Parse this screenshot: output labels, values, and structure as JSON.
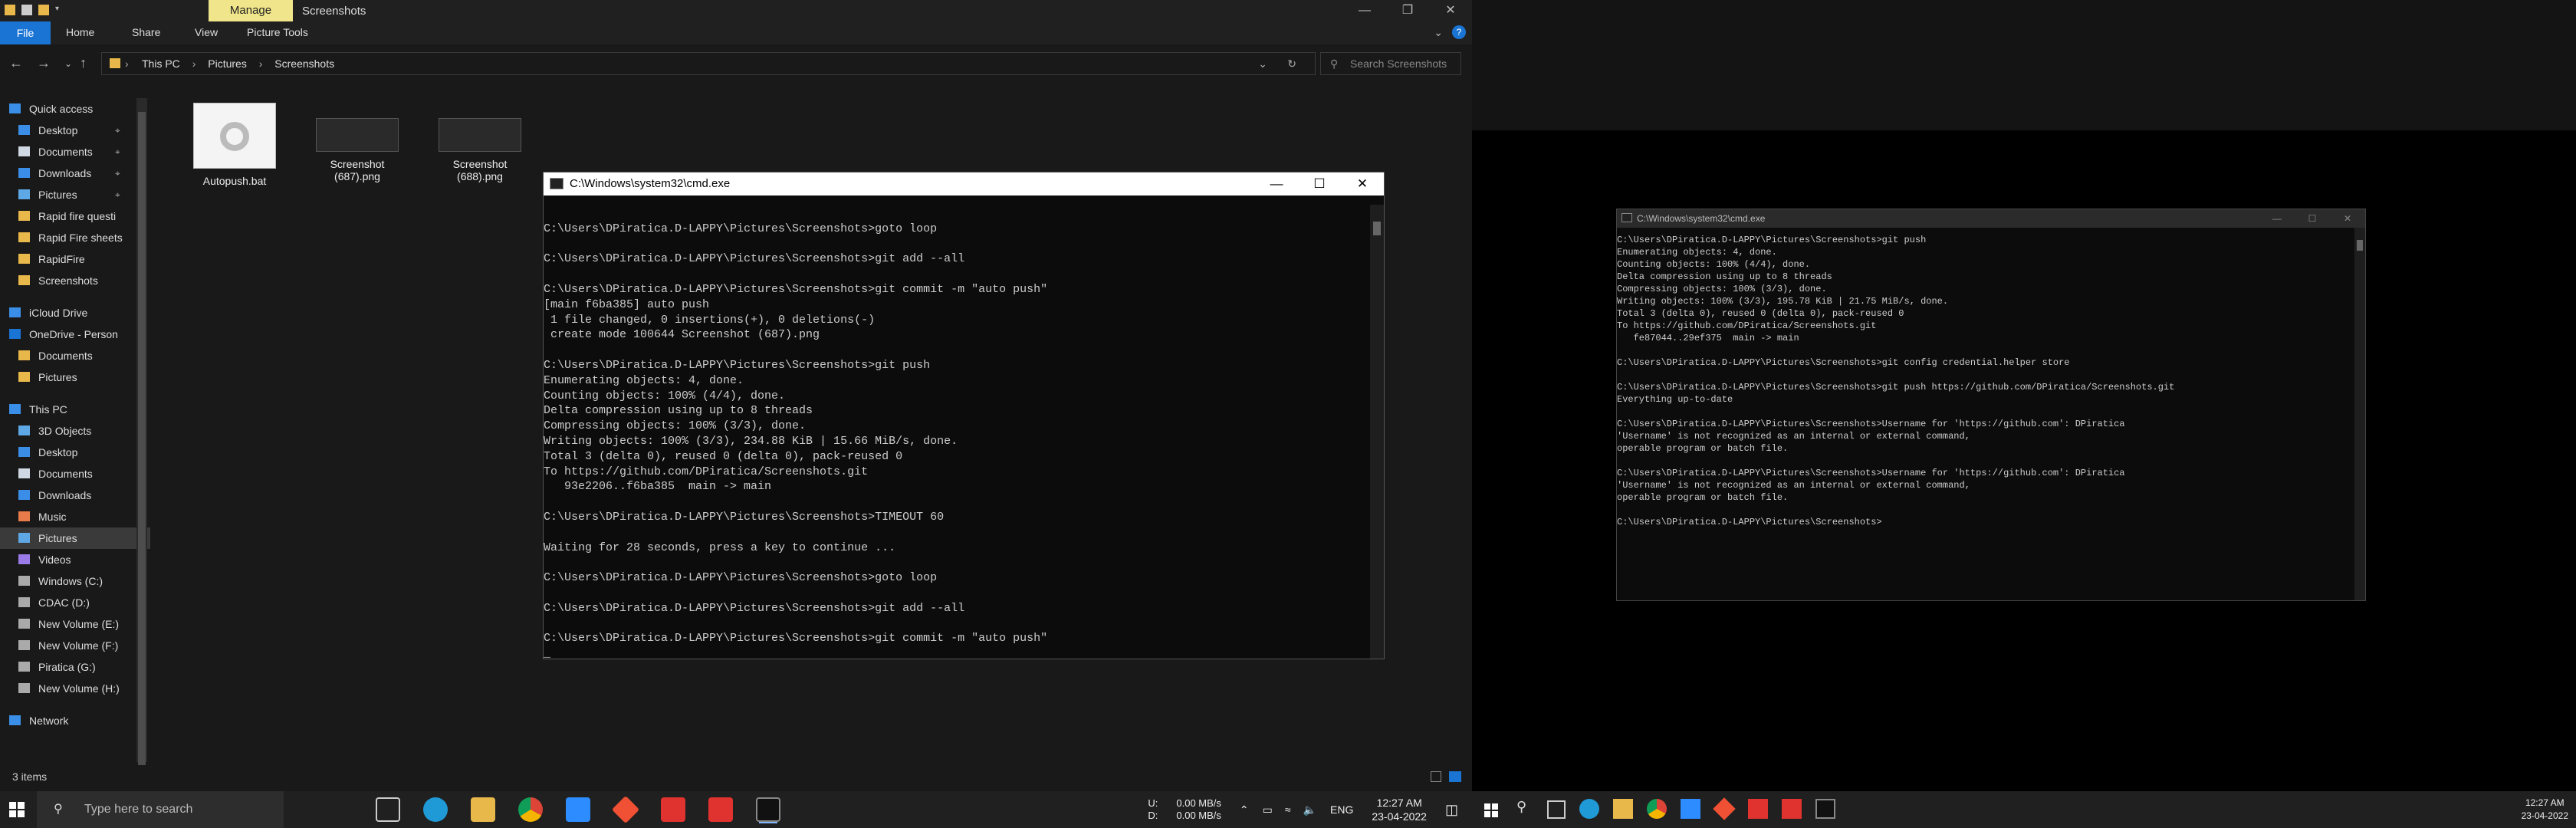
{
  "explorer": {
    "manage_tab": "Manage",
    "window_title": "Screenshots",
    "ribbon_tabs": [
      "File",
      "Home",
      "Share",
      "View",
      "Picture Tools"
    ],
    "breadcrumb": [
      "This PC",
      "Pictures",
      "Screenshots"
    ],
    "search_placeholder": "Search Screenshots",
    "nav_items": [
      {
        "label": "Quick access",
        "icon": "star-icon",
        "indent": 0
      },
      {
        "label": "Desktop",
        "icon": "desktop-icon",
        "indent": 1,
        "pinned": true
      },
      {
        "label": "Documents",
        "icon": "documents-icon",
        "indent": 1,
        "pinned": true
      },
      {
        "label": "Downloads",
        "icon": "downloads-icon",
        "indent": 1,
        "pinned": true
      },
      {
        "label": "Pictures",
        "icon": "pictures-icon",
        "indent": 1,
        "pinned": true
      },
      {
        "label": "Rapid fire questi",
        "icon": "folder-icon",
        "indent": 1
      },
      {
        "label": "Rapid Fire sheets",
        "icon": "folder-icon",
        "indent": 1
      },
      {
        "label": "RapidFire",
        "icon": "folder-icon",
        "indent": 1
      },
      {
        "label": "Screenshots",
        "icon": "folder-icon",
        "indent": 1
      },
      {
        "label": "iCloud Drive",
        "icon": "cloud-icon",
        "indent": 0
      },
      {
        "label": "OneDrive - Person",
        "icon": "onedrive-icon",
        "indent": 0
      },
      {
        "label": "Documents",
        "icon": "folder-icon",
        "indent": 1
      },
      {
        "label": "Pictures",
        "icon": "folder-icon",
        "indent": 1
      },
      {
        "label": "This PC",
        "icon": "pc-icon",
        "indent": 0
      },
      {
        "label": "3D Objects",
        "icon": "3d-objects-icon",
        "indent": 1
      },
      {
        "label": "Desktop",
        "icon": "desktop-icon",
        "indent": 1
      },
      {
        "label": "Documents",
        "icon": "documents-icon",
        "indent": 1
      },
      {
        "label": "Downloads",
        "icon": "downloads-icon",
        "indent": 1
      },
      {
        "label": "Music",
        "icon": "music-icon",
        "indent": 1
      },
      {
        "label": "Pictures",
        "icon": "pictures-icon",
        "indent": 1,
        "selected": true
      },
      {
        "label": "Videos",
        "icon": "videos-icon",
        "indent": 1
      },
      {
        "label": "Windows (C:)",
        "icon": "drive-icon",
        "indent": 1
      },
      {
        "label": "CDAC (D:)",
        "icon": "drive-icon",
        "indent": 1
      },
      {
        "label": "New Volume (E:)",
        "icon": "drive-icon",
        "indent": 1
      },
      {
        "label": "New Volume (F:)",
        "icon": "drive-icon",
        "indent": 1
      },
      {
        "label": "Piratica (G:)",
        "icon": "drive-icon",
        "indent": 1
      },
      {
        "label": "New Volume (H:)",
        "icon": "drive-icon",
        "indent": 1
      },
      {
        "label": "Network",
        "icon": "network-icon",
        "indent": 0
      }
    ],
    "files": [
      {
        "name": "Autopush.bat",
        "kind": "bat"
      },
      {
        "name": "Screenshot (687).png",
        "kind": "png"
      },
      {
        "name": "Screenshot (688).png",
        "kind": "png"
      }
    ],
    "status": "3 items"
  },
  "cmd_main": {
    "title": "C:\\Windows\\system32\\cmd.exe",
    "lines": [
      "",
      "C:\\Users\\DPiratica.D-LAPPY\\Pictures\\Screenshots>goto loop",
      "",
      "C:\\Users\\DPiratica.D-LAPPY\\Pictures\\Screenshots>git add --all",
      "",
      "C:\\Users\\DPiratica.D-LAPPY\\Pictures\\Screenshots>git commit -m \"auto push\"",
      "[main f6ba385] auto push",
      " 1 file changed, 0 insertions(+), 0 deletions(-)",
      " create mode 100644 Screenshot (687).png",
      "",
      "C:\\Users\\DPiratica.D-LAPPY\\Pictures\\Screenshots>git push",
      "Enumerating objects: 4, done.",
      "Counting objects: 100% (4/4), done.",
      "Delta compression using up to 8 threads",
      "Compressing objects: 100% (3/3), done.",
      "Writing objects: 100% (3/3), 234.88 KiB | 15.66 MiB/s, done.",
      "Total 3 (delta 0), reused 0 (delta 0), pack-reused 0",
      "To https://github.com/DPiratica/Screenshots.git",
      "   93e2206..f6ba385  main -> main",
      "",
      "C:\\Users\\DPiratica.D-LAPPY\\Pictures\\Screenshots>TIMEOUT 60",
      "",
      "Waiting for 28 seconds, press a key to continue ...",
      "",
      "C:\\Users\\DPiratica.D-LAPPY\\Pictures\\Screenshots>goto loop",
      "",
      "C:\\Users\\DPiratica.D-LAPPY\\Pictures\\Screenshots>git add --all",
      "",
      "C:\\Users\\DPiratica.D-LAPPY\\Pictures\\Screenshots>git commit -m \"auto push\"",
      "_"
    ]
  },
  "cmd_right": {
    "title": "C:\\Windows\\system32\\cmd.exe",
    "lines": [
      "C:\\Users\\DPiratica.D-LAPPY\\Pictures\\Screenshots>git push",
      "Enumerating objects: 4, done.",
      "Counting objects: 100% (4/4), done.",
      "Delta compression using up to 8 threads",
      "Compressing objects: 100% (3/3), done.",
      "Writing objects: 100% (3/3), 195.78 KiB | 21.75 MiB/s, done.",
      "Total 3 (delta 0), reused 0 (delta 0), pack-reused 0",
      "To https://github.com/DPiratica/Screenshots.git",
      "   fe87044..29ef375  main -> main",
      "",
      "C:\\Users\\DPiratica.D-LAPPY\\Pictures\\Screenshots>git config credential.helper store",
      "",
      "C:\\Users\\DPiratica.D-LAPPY\\Pictures\\Screenshots>git push https://github.com/DPiratica/Screenshots.git",
      "Everything up-to-date",
      "",
      "C:\\Users\\DPiratica.D-LAPPY\\Pictures\\Screenshots>Username for 'https://github.com': DPiratica",
      "'Username' is not recognized as an internal or external command,",
      "operable program or batch file.",
      "",
      "C:\\Users\\DPiratica.D-LAPPY\\Pictures\\Screenshots>Username for 'https://github.com': DPiratica",
      "'Username' is not recognized as an internal or external command,",
      "operable program or batch file.",
      "",
      "C:\\Users\\DPiratica.D-LAPPY\\Pictures\\Screenshots>"
    ]
  },
  "taskbar": {
    "search_placeholder": "Type here to search",
    "net_upload": "0.00 MB/s",
    "net_download": "0.00 MB/s",
    "net_u_label": "U:",
    "net_d_label": "D:",
    "language": "ENG",
    "time": "12:27 AM",
    "date": "23-04-2022",
    "apps": [
      "task-view-icon",
      "edge-icon",
      "file-explorer-icon",
      "chrome-icon",
      "zoom-icon",
      "git-icon",
      "anydesk-icon",
      "anydesk-icon",
      "cmd-icon"
    ]
  },
  "taskbar2": {
    "time": "12:27 AM",
    "date": "23-04-2022"
  },
  "colors": {
    "accent": "#1a74d4",
    "manage": "#f0e58a",
    "cmd_text": "#cccccc"
  }
}
